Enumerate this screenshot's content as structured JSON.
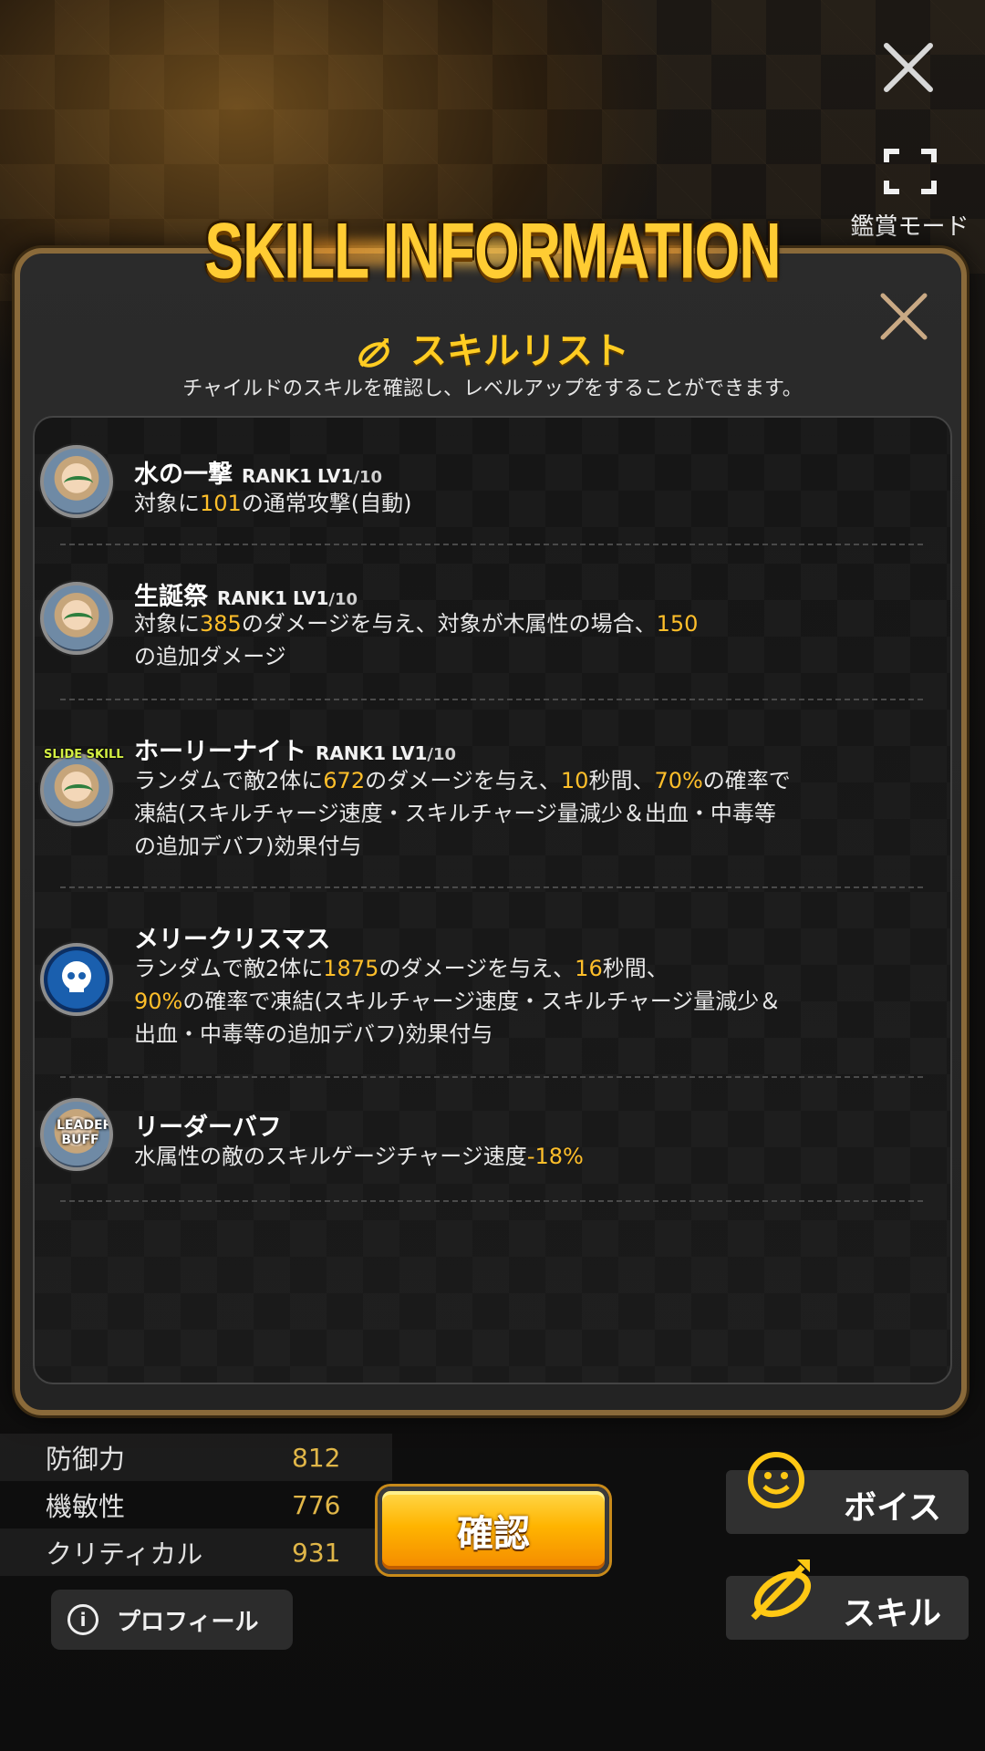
{
  "top": {
    "view_mode_label": "鑑賞モード"
  },
  "panel": {
    "banner_title": "SKILL INFORMATION",
    "section_title": "スキルリスト",
    "section_desc": "チャイルドのスキルを確認し、レベルアップをすることができます。"
  },
  "skills": [
    {
      "name": "水の一撃",
      "rank": "RANK1",
      "lv": "LV1",
      "lv_max": "/10",
      "desc_parts": [
        "対象に",
        "101",
        "の通常攻撃(自動)"
      ]
    },
    {
      "name": "生誕祭",
      "rank": "RANK1",
      "lv": "LV1",
      "lv_max": "/10",
      "desc_parts": [
        "対象に",
        "385",
        "のダメージを与え、対象が木属性の場合、",
        "150",
        "の追加ダメージ"
      ]
    },
    {
      "name": "ホーリーナイト",
      "rank": "RANK1",
      "lv": "LV1",
      "lv_max": "/10",
      "badge": "SLIDE SKILL",
      "desc_parts": [
        "ランダムで敵2体に",
        "672",
        "のダメージを与え、",
        "10",
        "秒間、",
        "70%",
        "の確率で凍結(スキルチャージ速度・スキルチャージ量減少＆出血・中毒等の追加デバフ)効果付与"
      ]
    },
    {
      "name": "メリークリスマス",
      "desc_parts": [
        "ランダムで敵2体に",
        "1875",
        "のダメージを与え、",
        "16",
        "秒間、",
        "90%",
        "の確率で凍結(スキルチャージ速度・スキルチャージ量減少＆出血・中毒等の追加デバフ)効果付与"
      ]
    },
    {
      "name": "リーダーバフ",
      "badge_top": "LEADER",
      "badge_bottom": "BUFF",
      "desc_parts": [
        "水属性の敵のスキルゲージチャージ速度",
        "-18%"
      ]
    }
  ],
  "stats": [
    {
      "label": "防御力",
      "value": "812"
    },
    {
      "label": "機敏性",
      "value": "776"
    },
    {
      "label": "クリティカル",
      "value": "931"
    }
  ],
  "buttons": {
    "confirm": "確認",
    "profile": "プロフィール",
    "voice": "ボイス",
    "skill": "スキル"
  },
  "colors": {
    "accent": "#ffbf2a",
    "panel_border": "#8a6a3a",
    "confirm": "#ffb400"
  }
}
